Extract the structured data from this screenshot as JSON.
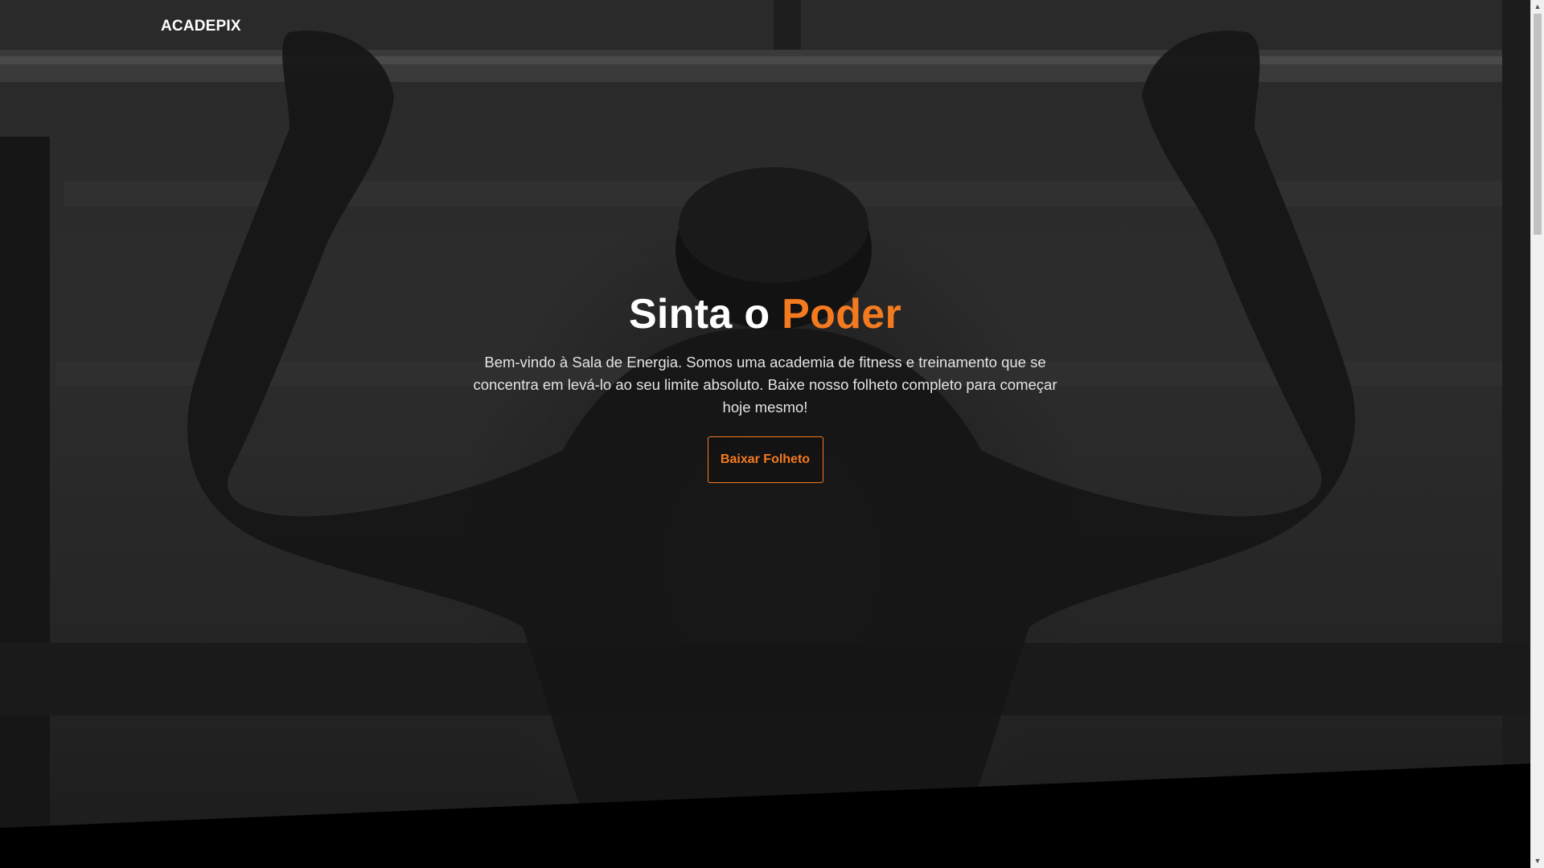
{
  "nav": {
    "logo_text": "ACADEPIX"
  },
  "hero": {
    "title_main": "Sinta o ",
    "title_accent": "Poder",
    "description": "Bem-vindo à Sala de Energia. Somos uma academia de fitness e treinamento que se concentra em levá-lo ao seu limite absoluto. Baixe nosso folheto completo para começar hoje mesmo!",
    "cta_label": "Baixar Folheto"
  },
  "scrollbar": {
    "up_icon": "▲",
    "down_icon": "▼"
  },
  "colors": {
    "accent": "#f47a20",
    "text": "#ffffff",
    "background": "#000000"
  }
}
